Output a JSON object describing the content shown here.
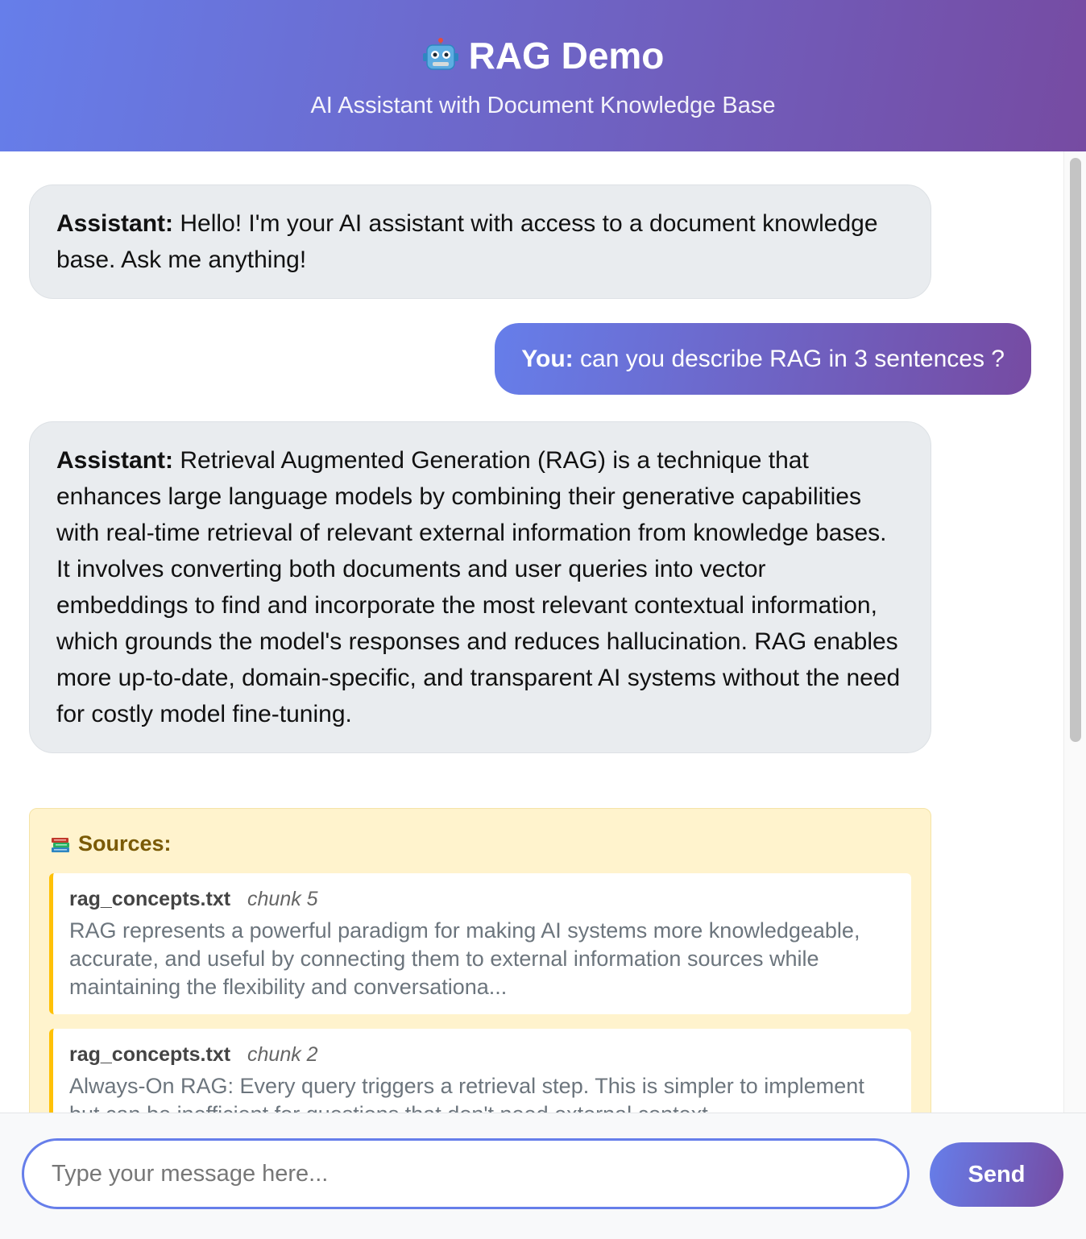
{
  "header": {
    "title": "RAG Demo",
    "title_icon": "robot-icon",
    "subtitle": "AI Assistant with Document Knowledge Base"
  },
  "messages": [
    {
      "role": "assistant",
      "speaker": "Assistant:",
      "text": "Hello! I'm your AI assistant with access to a document knowledge base. Ask me anything!"
    },
    {
      "role": "user",
      "speaker": "You:",
      "text": "can you describe RAG in 3 sentences ?"
    },
    {
      "role": "assistant",
      "speaker": "Assistant:",
      "text": "Retrieval Augmented Generation (RAG) is a technique that enhances large language models by combining their generative capabilities with real-time retrieval of relevant external information from knowledge bases. It involves converting both documents and user queries into vector embeddings to find and incorporate the most relevant contextual information, which grounds the model's responses and reduces hallucination. RAG enables more up-to-date, domain-specific, and transparent AI systems without the need for costly model fine-tuning."
    }
  ],
  "sources": {
    "title": "Sources:",
    "icon": "books-icon",
    "items": [
      {
        "file": "rag_concepts.txt",
        "chunk": "chunk 5",
        "text": "RAG represents a powerful paradigm for making AI systems more knowledgeable, accurate, and useful by connecting them to external information sources while maintaining the flexibility and conversationa..."
      },
      {
        "file": "rag_concepts.txt",
        "chunk": "chunk 2",
        "text": "Always-On RAG: Every query triggers a retrieval step. This is simpler to implement but can be inefficient for questions that don't need external context."
      }
    ]
  },
  "input": {
    "placeholder": "Type your message here...",
    "value": "",
    "send_label": "Send"
  },
  "colors": {
    "gradient_start": "#667eea",
    "gradient_end": "#764ba2",
    "assistant_bubble": "#e9ecef",
    "sources_background": "#fff3cd",
    "source_accent": "#ffc107"
  }
}
